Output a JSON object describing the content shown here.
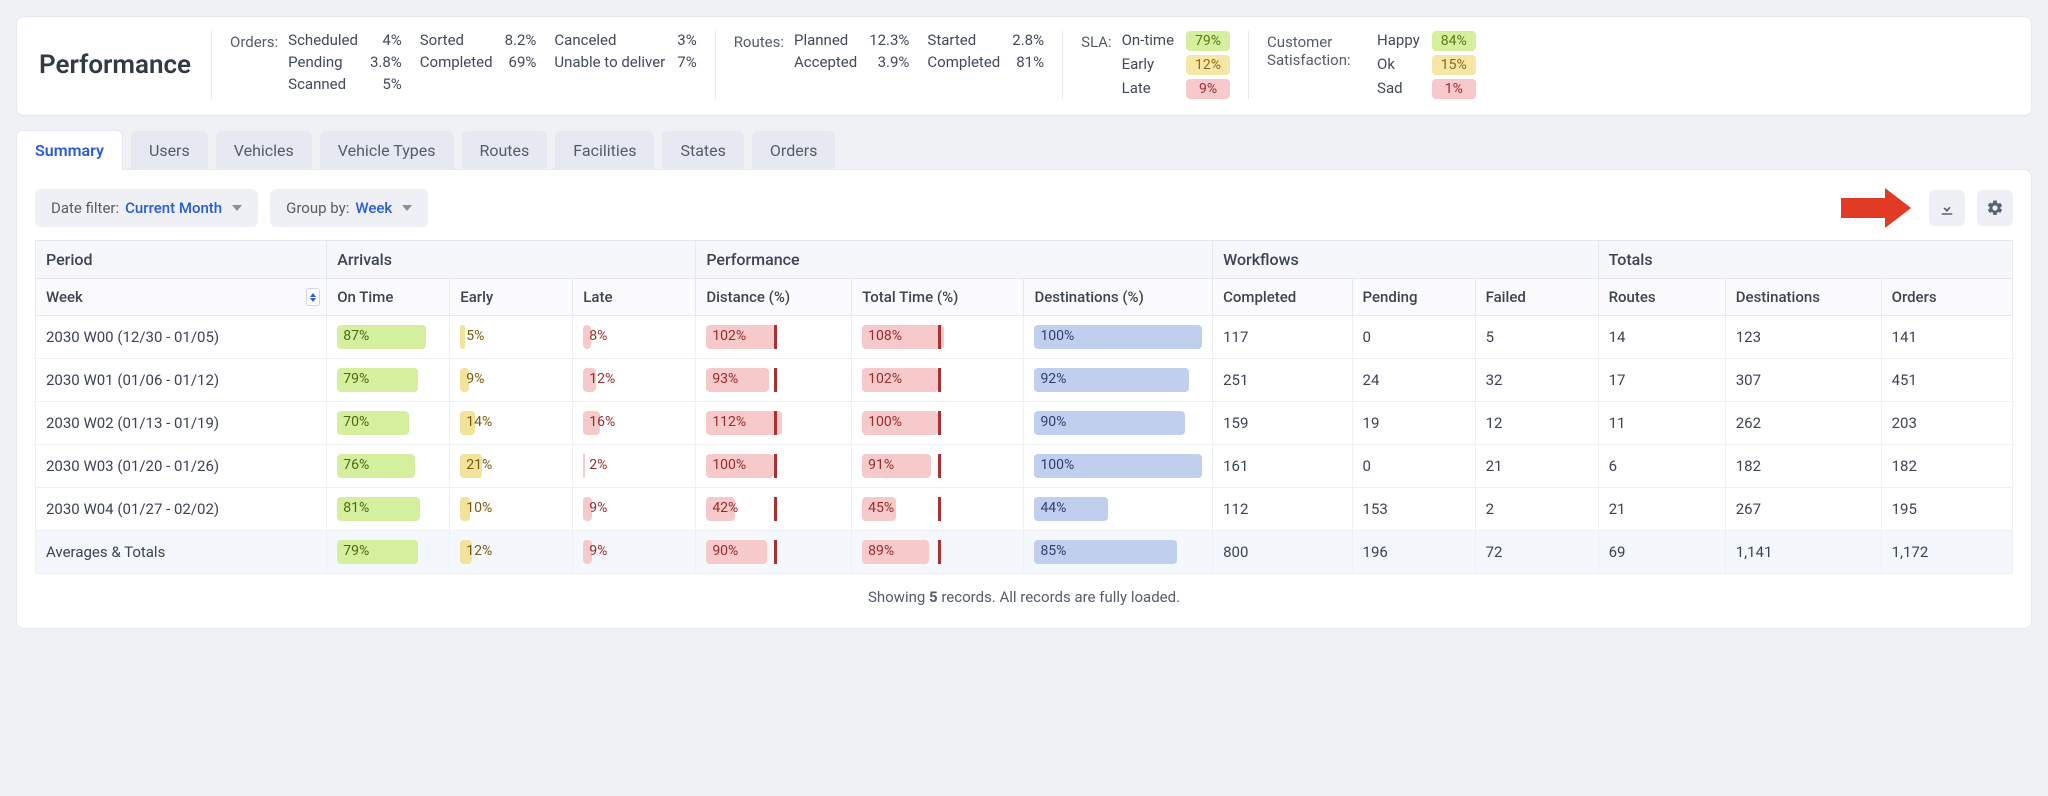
{
  "title": "Performance",
  "header": {
    "orders": {
      "label": "Orders:",
      "items": [
        {
          "k": "Scheduled",
          "v": "4%"
        },
        {
          "k": "Pending",
          "v": "3.8%"
        },
        {
          "k": "Scanned",
          "v": "5%"
        },
        {
          "k": "Sorted",
          "v": "8.2%"
        },
        {
          "k": "Completed",
          "v": "69%"
        },
        {
          "k": "Canceled",
          "v": "3%"
        },
        {
          "k": "Unable to deliver",
          "v": "7%"
        }
      ]
    },
    "routes": {
      "label": "Routes:",
      "items": [
        {
          "k": "Planned",
          "v": "12.3%"
        },
        {
          "k": "Accepted",
          "v": "3.9%"
        },
        {
          "k": "Started",
          "v": "2.8%"
        },
        {
          "k": "Completed",
          "v": "81%"
        }
      ]
    },
    "sla": {
      "label": "SLA:",
      "items": [
        {
          "k": "On-time",
          "v": "79%",
          "cls": "b-green"
        },
        {
          "k": "Early",
          "v": "12%",
          "cls": "b-yellow"
        },
        {
          "k": "Late",
          "v": "9%",
          "cls": "b-red"
        }
      ]
    },
    "csat": {
      "label": "Customer Satisfaction:",
      "items": [
        {
          "k": "Happy",
          "v": "84%",
          "cls": "b-green"
        },
        {
          "k": "Ok",
          "v": "15%",
          "cls": "b-yellow"
        },
        {
          "k": "Sad",
          "v": "1%",
          "cls": "b-red"
        }
      ]
    }
  },
  "tabs": [
    "Summary",
    "Users",
    "Vehicles",
    "Vehicle Types",
    "Routes",
    "Facilities",
    "States",
    "Orders"
  ],
  "active_tab": "Summary",
  "filters": {
    "date_label": "Date filter: ",
    "date_value": "Current Month",
    "group_label": "Group by: ",
    "group_value": "Week"
  },
  "table": {
    "groups": [
      {
        "label": "Period",
        "span": 1
      },
      {
        "label": "Arrivals",
        "span": 3
      },
      {
        "label": "Performance",
        "span": 3
      },
      {
        "label": "Workflows",
        "span": 3
      },
      {
        "label": "Totals",
        "span": 3
      }
    ],
    "cols": [
      "Week",
      "On Time",
      "Early",
      "Late",
      "Distance (%)",
      "Total Time (%)",
      "Destinations (%)",
      "Completed",
      "Pending",
      "Failed",
      "Routes",
      "Destinations",
      "Orders"
    ],
    "rows": [
      {
        "week": "2030 W00 (12/30 - 01/05)",
        "ontime": 87,
        "early": 5,
        "late": 8,
        "dist": 102,
        "time": 108,
        "dest": 100,
        "completed": "117",
        "pending": "0",
        "failed": "5",
        "routes": "14",
        "destinations": "123",
        "orders": "141"
      },
      {
        "week": "2030 W01 (01/06 - 01/12)",
        "ontime": 79,
        "early": 9,
        "late": 12,
        "dist": 93,
        "time": 102,
        "dest": 92,
        "completed": "251",
        "pending": "24",
        "failed": "32",
        "routes": "17",
        "destinations": "307",
        "orders": "451"
      },
      {
        "week": "2030 W02 (01/13 - 01/19)",
        "ontime": 70,
        "early": 14,
        "late": 16,
        "dist": 112,
        "time": 100,
        "dest": 90,
        "completed": "159",
        "pending": "19",
        "failed": "12",
        "routes": "11",
        "destinations": "262",
        "orders": "203"
      },
      {
        "week": "2030 W03 (01/20 - 01/26)",
        "ontime": 76,
        "early": 21,
        "late": 2,
        "dist": 100,
        "time": 91,
        "dest": 100,
        "completed": "161",
        "pending": "0",
        "failed": "21",
        "routes": "6",
        "destinations": "182",
        "orders": "182"
      },
      {
        "week": "2030 W04 (01/27 - 02/02)",
        "ontime": 81,
        "early": 10,
        "late": 9,
        "dist": 42,
        "time": 45,
        "dest": 44,
        "completed": "112",
        "pending": "153",
        "failed": "2",
        "routes": "21",
        "destinations": "267",
        "orders": "195"
      }
    ],
    "totals": {
      "week": "Averages & Totals",
      "ontime": 79,
      "early": 12,
      "late": 9,
      "dist": 90,
      "time": 89,
      "dest": 85,
      "completed": "800",
      "pending": "196",
      "failed": "72",
      "routes": "69",
      "destinations": "1,141",
      "orders": "1,172"
    }
  },
  "footer": {
    "prefix": "Showing ",
    "count": "5",
    "suffix": " records. All records are fully loaded."
  }
}
